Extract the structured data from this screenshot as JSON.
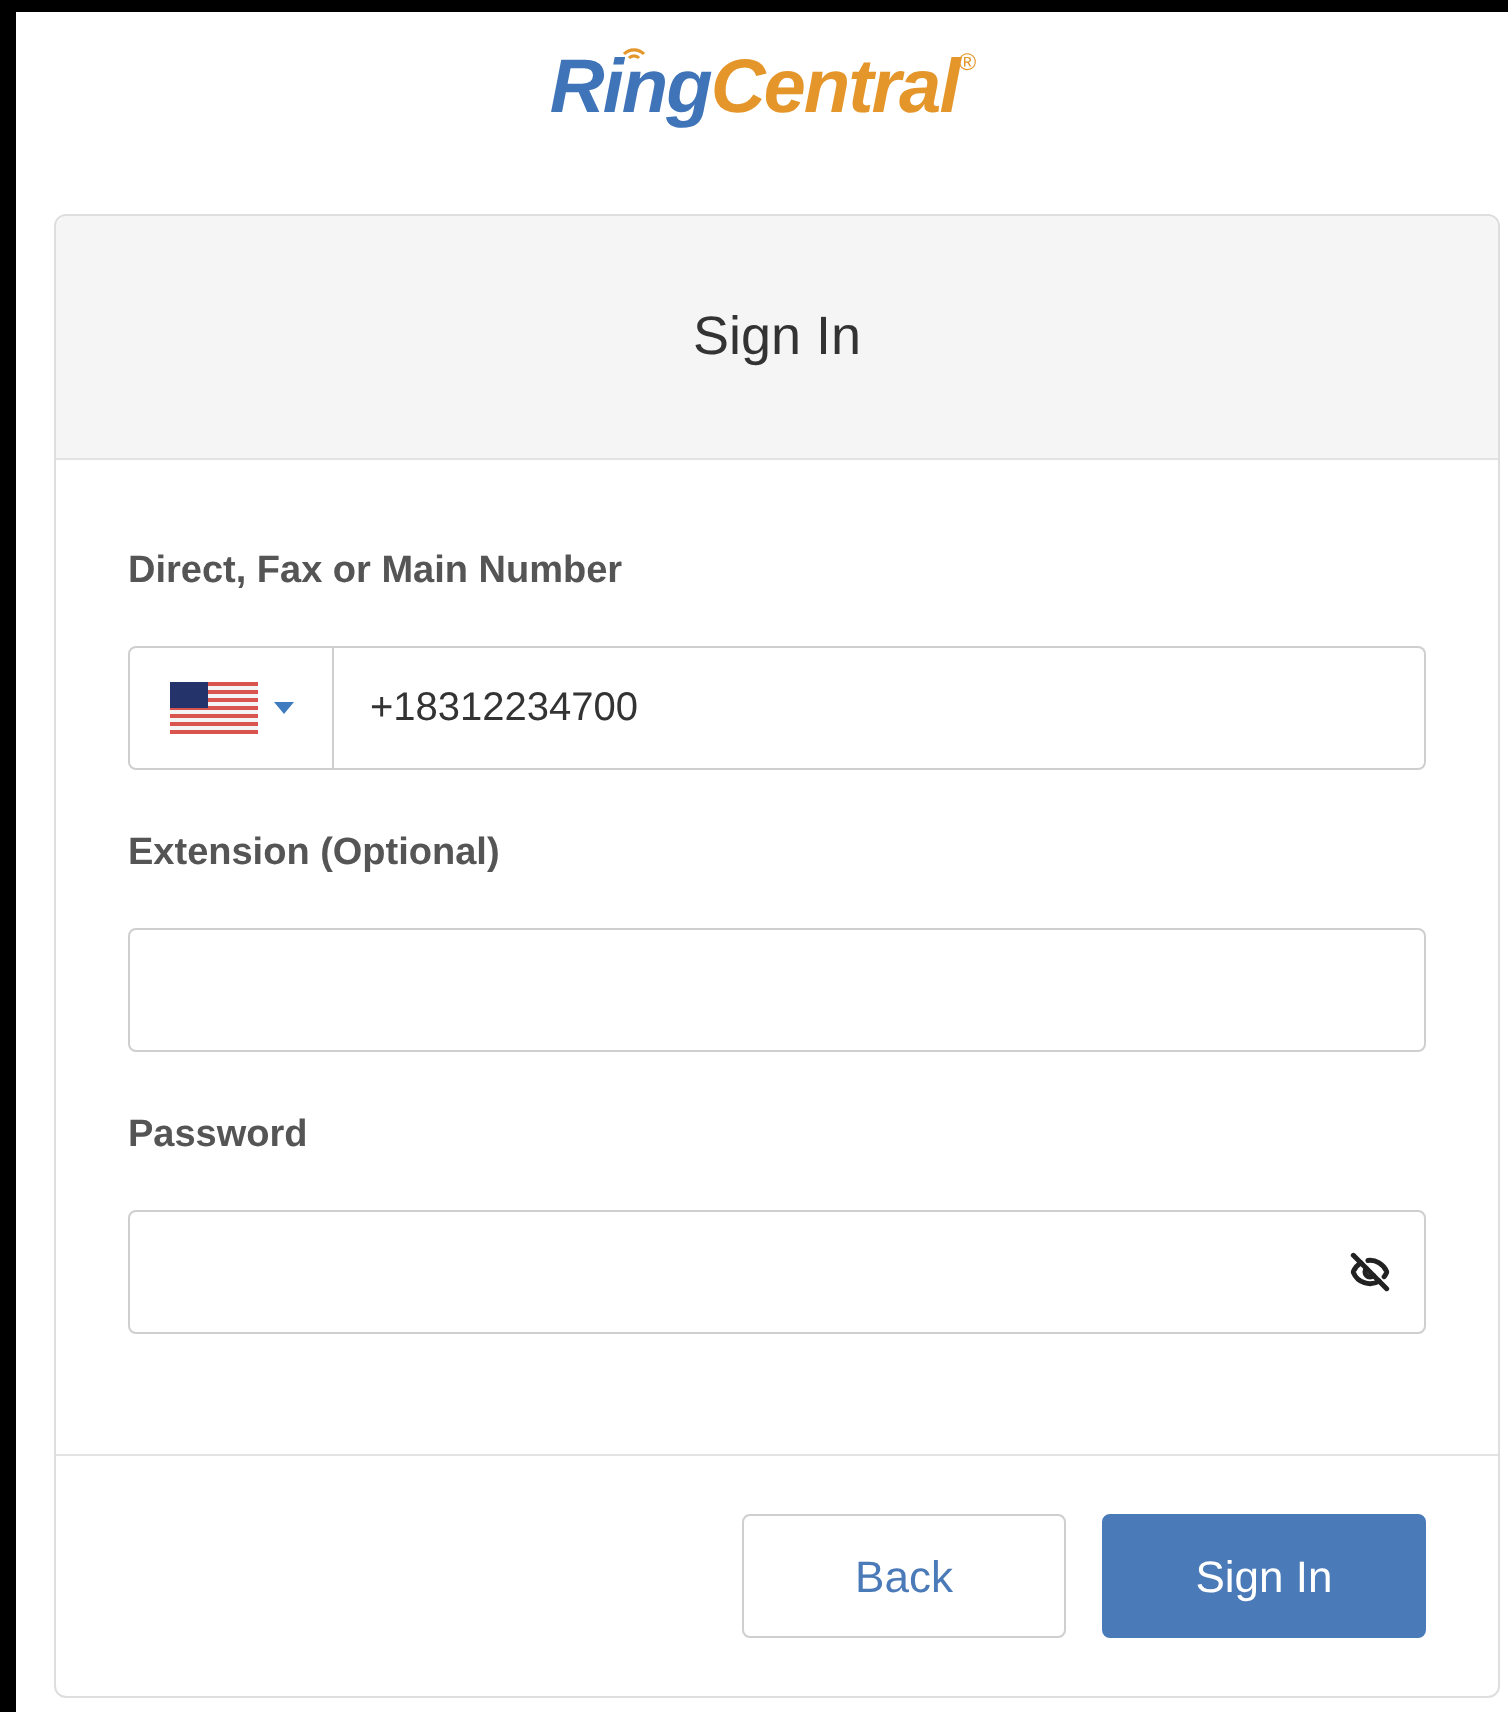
{
  "logo": {
    "part_1": "Ring",
    "part_2": "Central",
    "mark": "®"
  },
  "card": {
    "title": "Sign In",
    "fields": [
      {
        "kind": "phone",
        "label": "Direct, Fax or Main Number",
        "value": "+18312234700"
      },
      {
        "kind": "text",
        "label": "Extension (Optional)"
      },
      {
        "kind": "password",
        "label": "Password",
        "revealed": false
      }
    ],
    "buttons": [
      {
        "kind": "secondary",
        "label": "Back"
      },
      {
        "kind": "primary",
        "label": "Sign In"
      }
    ]
  }
}
